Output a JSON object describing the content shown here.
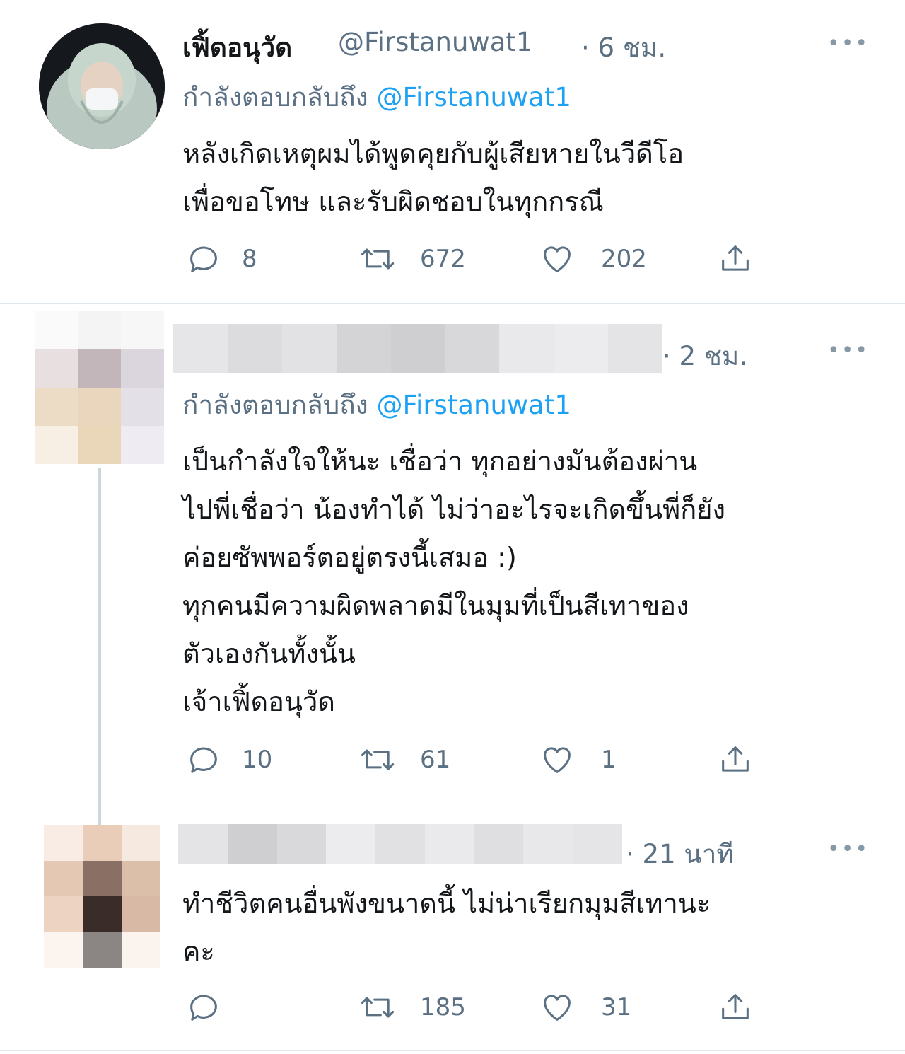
{
  "tweets": [
    {
      "name": "เฟิ้ดอนุวัด",
      "handle": "@Firstanuwat1",
      "time": "· 6 ชม.",
      "reply_prefix": "กำลังตอบกลับถึง",
      "reply_to": "@Firstanuwat1",
      "text": "หลังเกิดเหตุผมได้พูดคุยกับผู้เสียหายในวีดีโอ\nเพื่อขอโทษ และรับผิดชอบในทุกกรณี",
      "more": "•••",
      "replies": "8",
      "retweets": "672",
      "likes": "202"
    },
    {
      "time": "· 2 ชม.",
      "reply_prefix": "กำลังตอบกลับถึง",
      "reply_to": "@Firstanuwat1",
      "text": "เป็นกำลังใจให้นะ เชื่อว่า ทุกอย่างมันต้องผ่าน\nไปพี่เชื่อว่า น้องทำได้ ไม่ว่าอะไรจะเกิดขึ้นพี่ก็ยัง\nค่อยซัพพอร์ตอยู่ตรงนี้เสมอ :)\nทุกคนมีความผิดพลาดมีในมุมที่เป็นสีเทาของ\nตัวเองกันทั้งนั้น\nเจ้าเฟิ้ดอนุวัด",
      "more": "•••",
      "replies": "10",
      "retweets": "61",
      "likes": "1"
    },
    {
      "time": "· 21 นาที",
      "text": "ทำชีวิตคนอื่นพังขนาดนี้ ไม่น่าเรียกมุมสีเทานะ\nคะ",
      "more": "•••",
      "replies": "",
      "retweets": "185",
      "likes": "31"
    }
  ],
  "icons": [
    "reply-icon",
    "retweet-icon",
    "like-icon",
    "share-icon"
  ],
  "colors": {
    "accent": "#1da1f2",
    "secondary_text": "#5b7083",
    "divider": "#e1e8ed"
  }
}
